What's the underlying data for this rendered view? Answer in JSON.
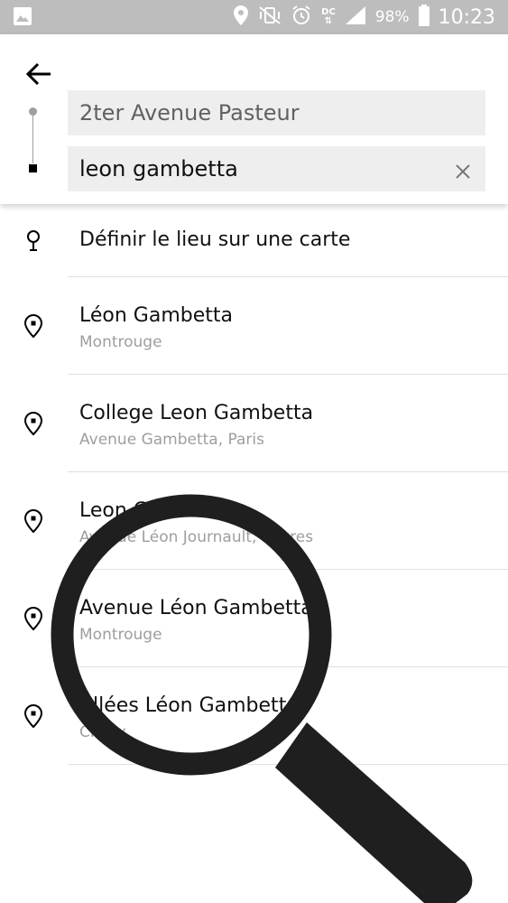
{
  "status_bar": {
    "battery": "98%",
    "time": "10:23",
    "dc_top": "DC",
    "dc_bottom": "⇅"
  },
  "search": {
    "from_value": "2ter Avenue Pasteur",
    "to_value": "leon gambetta"
  },
  "results": [
    {
      "title": "Définir le lieu sur une carte",
      "subtitle": "",
      "icon": "map-pin-icon"
    },
    {
      "title": "Léon Gambetta",
      "subtitle": "Montrouge",
      "icon": "location-icon"
    },
    {
      "title": "College Leon Gambetta",
      "subtitle": "Avenue Gambetta, Paris",
      "icon": "location-icon"
    },
    {
      "title": "Leon Gambetta",
      "subtitle": "Avenue Léon Journault, Sèvres",
      "icon": "location-icon"
    },
    {
      "title": "Avenue Léon Gambetta",
      "subtitle": "Montrouge",
      "icon": "location-icon"
    },
    {
      "title": "Allées Léon Gambetta",
      "subtitle": "Clichy",
      "icon": "location-icon"
    }
  ],
  "overlay": {
    "icon": "magnifying-glass-icon",
    "color": "#1f1f1f"
  }
}
